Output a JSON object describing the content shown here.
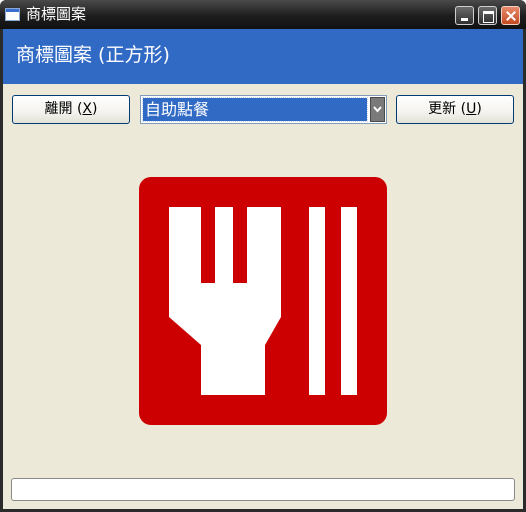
{
  "window": {
    "title": "商標圖案"
  },
  "header": {
    "title": "商標圖案 (正方形)"
  },
  "toolbar": {
    "exit_label": "離開 (",
    "exit_key": "X",
    "exit_suffix": ")",
    "update_label": "更新 (",
    "update_key": "U",
    "update_suffix": ")",
    "category_selected": "自助點餐"
  },
  "logo": {
    "icon": "fork-and-bars-icon",
    "background_color": "#cc0000",
    "foreground_color": "#ffffff"
  },
  "status": {
    "text": ""
  },
  "colors": {
    "header_band": "#316ac5",
    "client_bg": "#ece9d8"
  }
}
